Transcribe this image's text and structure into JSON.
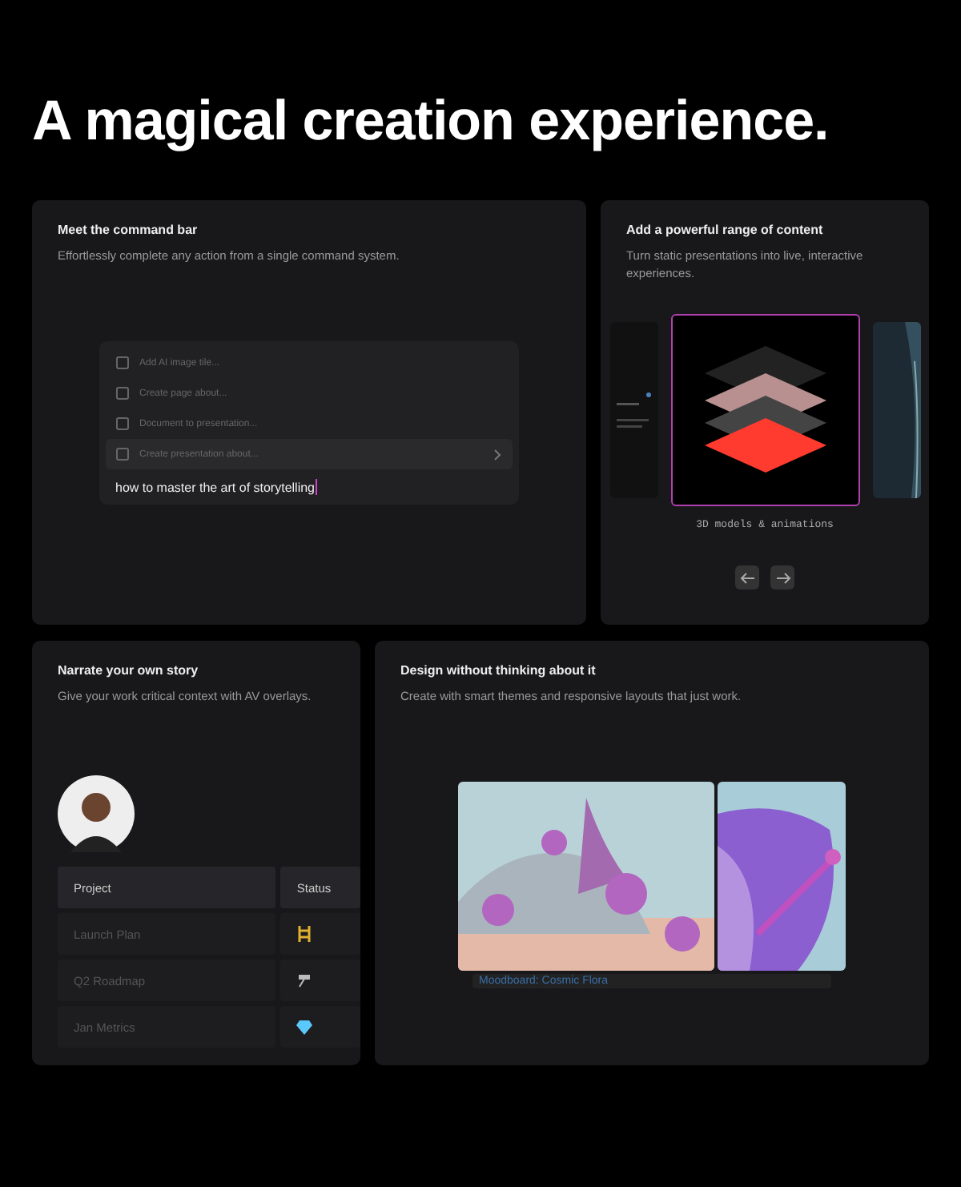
{
  "headline": "A magical creation experience.",
  "command_card": {
    "title": "Meet the command bar",
    "subtitle": "Effortlessly complete any action from a single command system.",
    "menu": [
      {
        "label": "Add AI image tile...",
        "selected": false
      },
      {
        "label": "Create page about...",
        "selected": false
      },
      {
        "label": "Document to presentation...",
        "selected": false
      },
      {
        "label": "Create presentation about...",
        "selected": true
      }
    ],
    "input": "how to master the art of storytelling"
  },
  "content_card": {
    "title": "Add a powerful range of content",
    "subtitle": "Turn static presentations into live, interactive experiences.",
    "slides": [
      {
        "kind": "doc",
        "selected": false
      },
      {
        "kind": "layers",
        "selected": true
      },
      {
        "kind": "picture",
        "selected": false
      }
    ],
    "caption": "3D models & animations"
  },
  "narrate_card": {
    "title": "Narrate your own story",
    "subtitle": "Give your work critical context with AV overlays.",
    "columns": [
      "Project",
      "Status"
    ],
    "rows": [
      {
        "project": "Launch Plan"
      },
      {
        "project": "Q2 Roadmap"
      },
      {
        "project": "Jan Metrics"
      }
    ]
  },
  "design_card": {
    "title": "Design without thinking about it",
    "subtitle": "Create with smart themes and responsive layouts that just work.",
    "caption": "Moodboard: Cosmic Flora"
  }
}
